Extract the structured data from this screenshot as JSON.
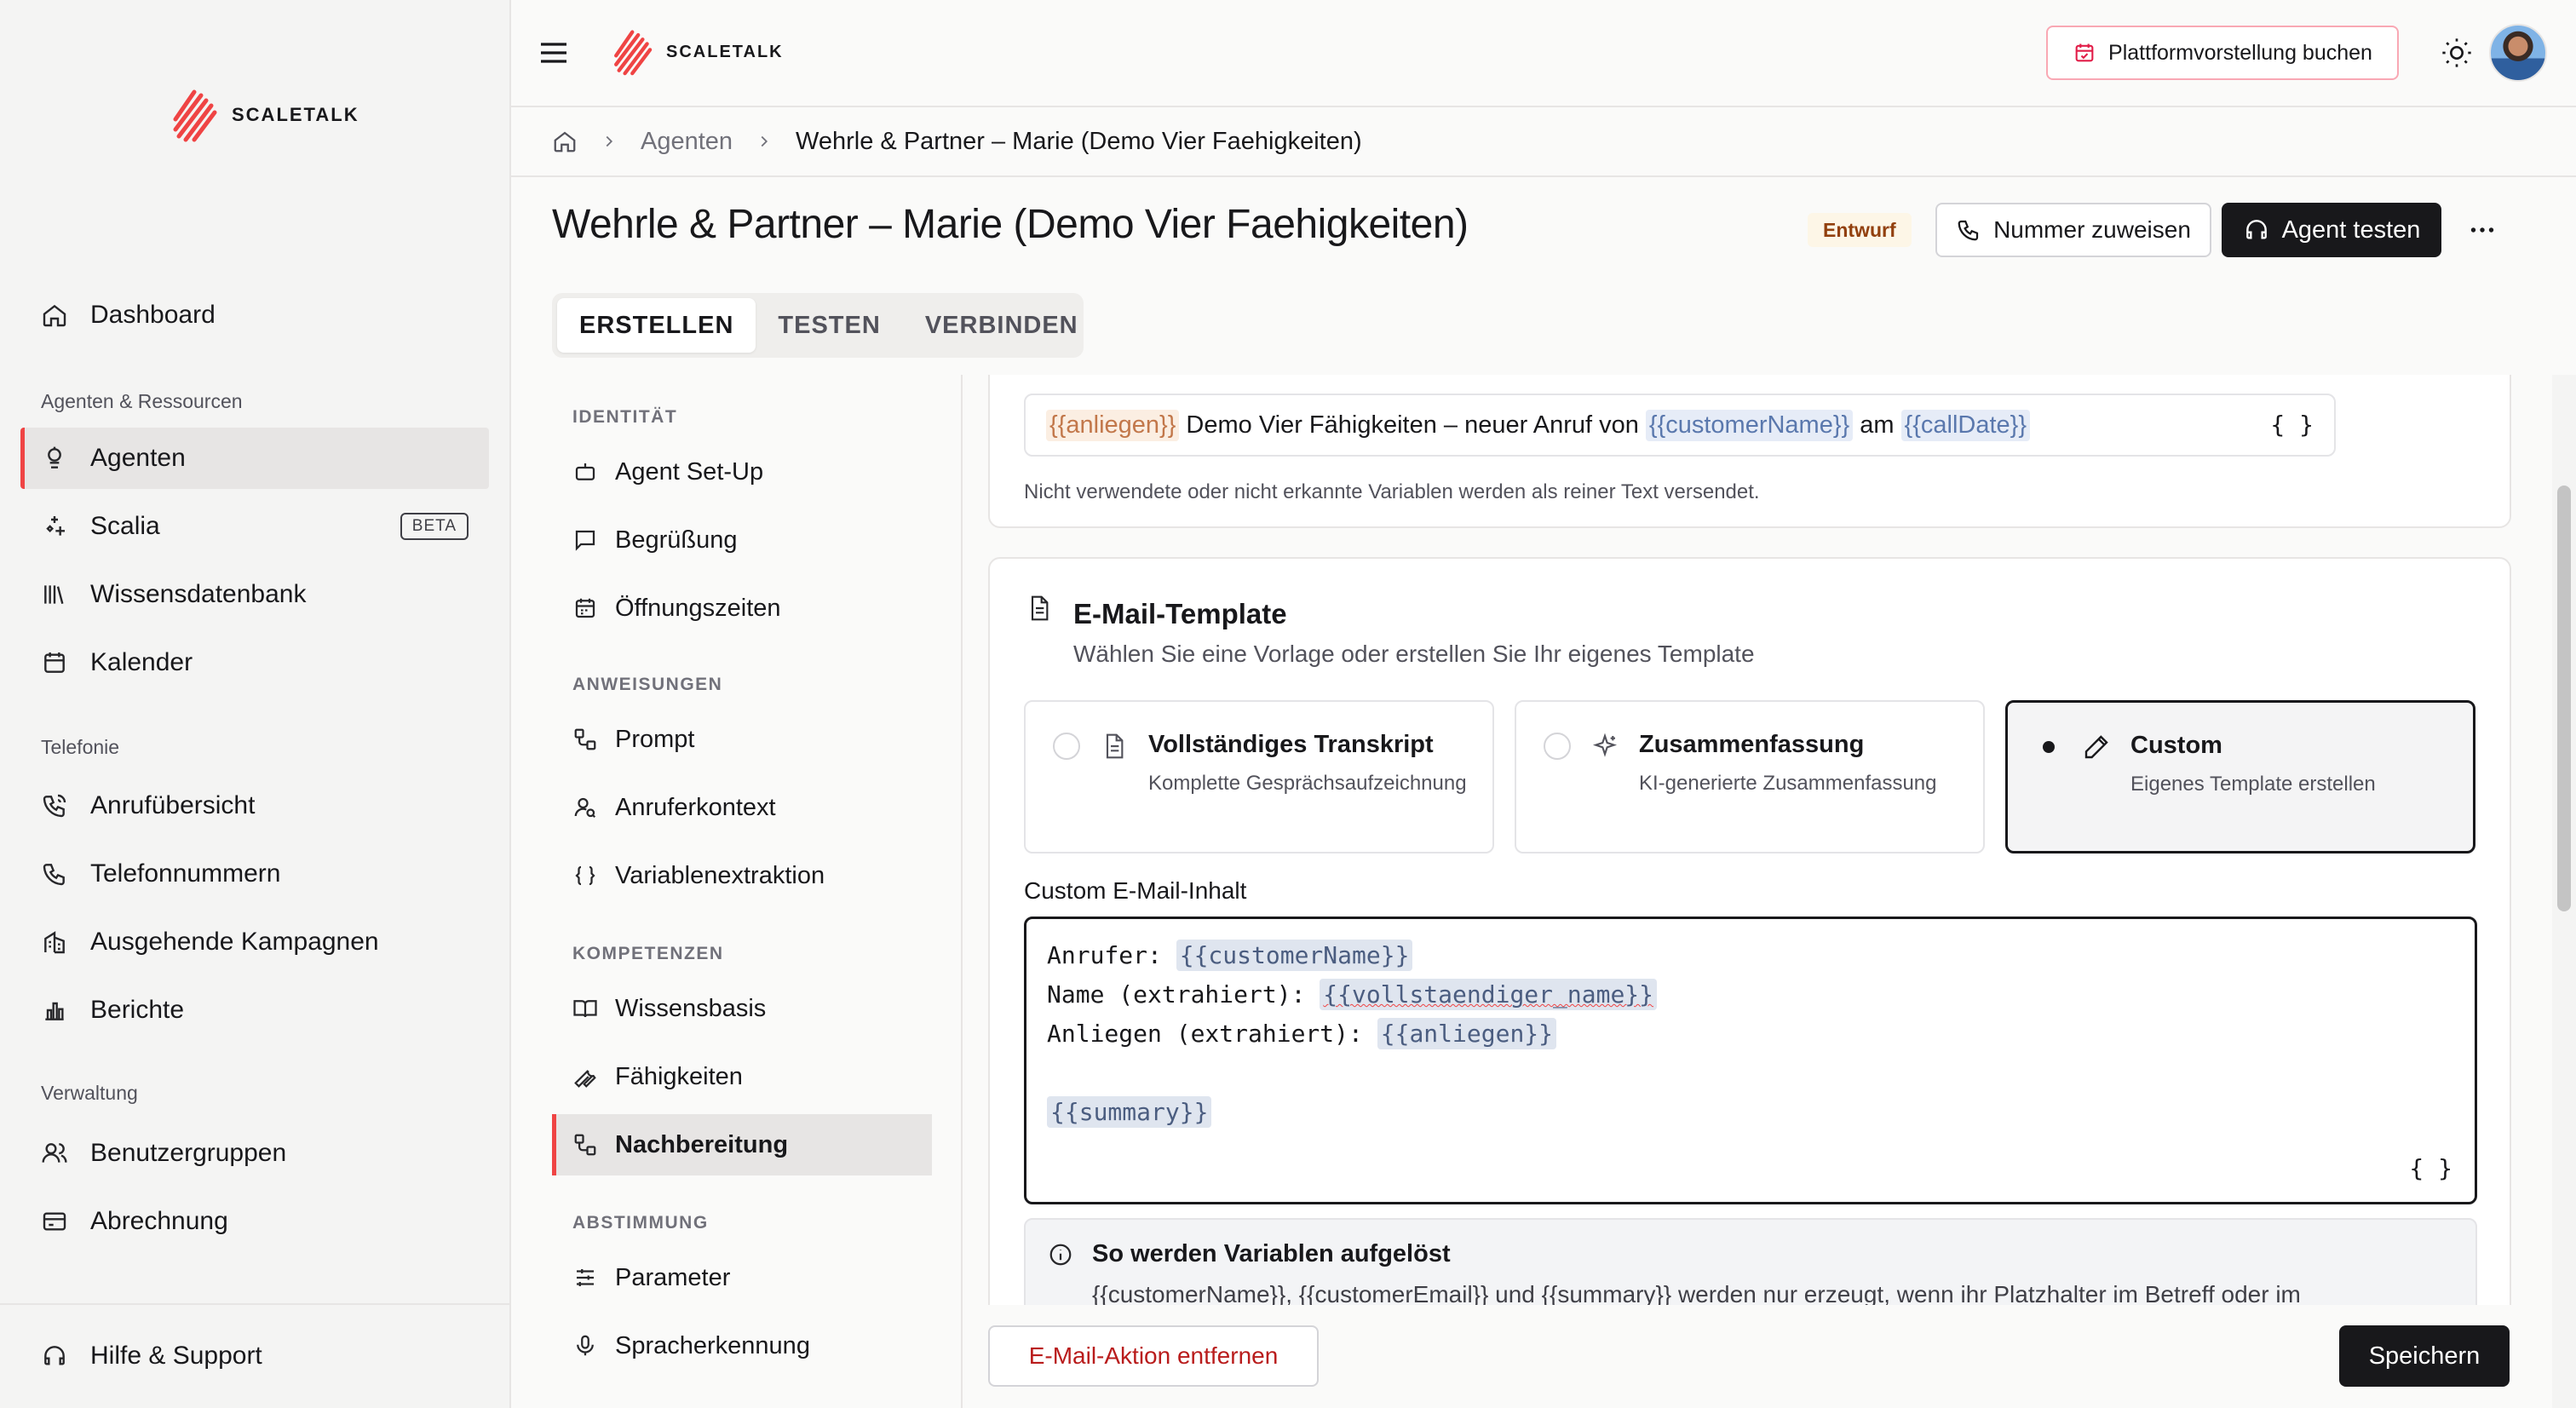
{
  "brand": {
    "name": "SCALETALK"
  },
  "sidebar": {
    "items": [
      {
        "label": "Dashboard"
      },
      {
        "label": "Agenten"
      },
      {
        "label": "Scalia",
        "badge": "BETA"
      },
      {
        "label": "Wissensdatenbank"
      },
      {
        "label": "Kalender"
      },
      {
        "label": "Anrufübersicht"
      },
      {
        "label": "Telefonnummern"
      },
      {
        "label": "Ausgehende Kampagnen"
      },
      {
        "label": "Berichte"
      },
      {
        "label": "Benutzergruppen"
      },
      {
        "label": "Abrechnung"
      },
      {
        "label": "Hilfe & Support"
      }
    ],
    "sections": [
      "Agenten & Ressourcen",
      "Telefonie",
      "Verwaltung"
    ]
  },
  "topbar": {
    "demo_button": "Plattformvorstellung buchen"
  },
  "breadcrumb": {
    "level1": "Agenten",
    "level2": "Wehrle & Partner – Marie (Demo Vier Faehigkeiten)"
  },
  "header": {
    "title": "Wehrle & Partner – Marie (Demo Vier Faehigkeiten)",
    "status": "Entwurf",
    "assign_button": "Nummer zuweisen",
    "test_button": "Agent testen"
  },
  "tabs": [
    "ERSTELLEN",
    "TESTEN",
    "VERBINDEN"
  ],
  "subnav": {
    "sections": [
      "IDENTITÄT",
      "ANWEISUNGEN",
      "KOMPETENZEN",
      "ABSTIMMUNG"
    ],
    "items": [
      "Agent Set-Up",
      "Begrüßung",
      "Öffnungszeiten",
      "Prompt",
      "Anruferkontext",
      "Variablenextraktion",
      "Wissensbasis",
      "Fähigkeiten",
      "Nachbereitung",
      "Parameter",
      "Spracherkennung"
    ]
  },
  "subject": {
    "var1": "{{anliegen}}",
    "text1": "Demo Vier Fähigkeiten – neuer Anruf von",
    "var2": "{{customerName}}",
    "text2": "am",
    "var3": "{{callDate}}",
    "braces": "{ }",
    "hint": "Nicht verwendete oder nicht erkannte Variablen werden als reiner Text versendet."
  },
  "template": {
    "title": "E-Mail-Template",
    "subtitle": "Wählen Sie eine Vorlage oder erstellen Sie Ihr eigenes Template",
    "options": [
      {
        "title": "Vollständiges Transkript",
        "desc": "Komplette Gesprächsaufzeichnung",
        "icon": "document-icon"
      },
      {
        "title": "Zusammenfassung",
        "desc": "KI-generierte Zusammenfassung",
        "icon": "sparkles-icon"
      },
      {
        "title": "Custom",
        "desc": "Eigenes Template erstellen",
        "icon": "pencil-icon",
        "selected": true
      }
    ],
    "content_label": "Custom E-Mail-Inhalt",
    "lines": [
      {
        "prefix": "Anrufer: ",
        "var": "{{customerName}}"
      },
      {
        "prefix": "Name (extrahiert): ",
        "var": "{{vollstaendiger_name}}"
      },
      {
        "prefix": "Anliegen (extrahiert): ",
        "var": "{{anliegen}}"
      },
      {
        "prefix": "",
        "var": ""
      },
      {
        "prefix": "",
        "var": "{{summary}}"
      }
    ],
    "braces": "{ }"
  },
  "info": {
    "title": "So werden Variablen aufgelöst",
    "text": "{{customerName}}, {{customerEmail}} und {{summary}} werden nur erzeugt, wenn ihr Platzhalter im Betreff oder im"
  },
  "footer": {
    "remove_button": "E-Mail-Aktion entfernen",
    "save_button": "Speichern"
  },
  "colors": {
    "accent": "#ef4444",
    "primary": "#18181b",
    "badge_bg": "#fdf6e7",
    "badge_text": "#92400e"
  }
}
